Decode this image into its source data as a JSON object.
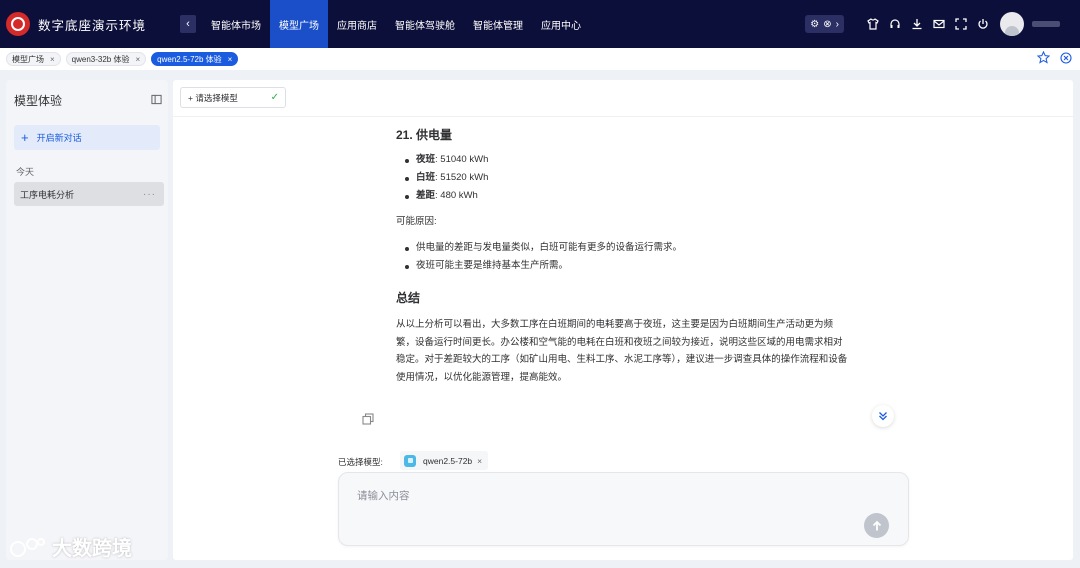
{
  "brand": {
    "title": "数字底座演示环境"
  },
  "nav": {
    "back_icon": "chevron-left-icon",
    "items": [
      {
        "label": "智能体市场",
        "active": false
      },
      {
        "label": "模型广场",
        "active": true
      },
      {
        "label": "应用商店",
        "active": false
      },
      {
        "label": "智能体驾驶舱",
        "active": false
      },
      {
        "label": "智能体管理",
        "active": false
      },
      {
        "label": "应用中心",
        "active": false
      }
    ]
  },
  "tabs": [
    {
      "label": "模型广场",
      "active": false
    },
    {
      "label": "qwen3-32b 体验",
      "active": false
    },
    {
      "label": "qwen2.5-72b 体验",
      "active": true
    }
  ],
  "sidebar": {
    "title": "模型体验",
    "new_chat": "开启新对话",
    "section": "今天",
    "conversations": [
      {
        "title": "工序电耗分析"
      }
    ]
  },
  "main": {
    "model_select": "+ 请选择模型",
    "content": {
      "heading1": "21. 供电量",
      "items": [
        {
          "key": "夜班",
          "value": ": 51040 kWh"
        },
        {
          "key": "白班",
          "value": ": 51520 kWh"
        },
        {
          "key": "差距",
          "value": ": 480 kWh"
        }
      ],
      "reason_label": "可能原因:",
      "reasons": [
        "供电量的差距与发电量类似，白班可能有更多的设备运行需求。",
        "夜班可能主要是维持基本生产所需。"
      ],
      "heading2": "总结",
      "summary": "从以上分析可以看出，大多数工序在白班期间的电耗要高于夜班，这主要是因为白班期间生产活动更为频繁，设备运行时间更长。办公楼和空气能的电耗在白班和夜班之间较为接近，说明这些区域的用电需求相对稳定。对于差距较大的工序（如矿山用电、生料工序、水泥工序等），建议进一步调查具体的操作流程和设备使用情况，以优化能源管理，提高能效。"
    },
    "selected_label": "已选择模型:",
    "selected_model": "qwen2.5-72b",
    "input_placeholder": "请输入内容"
  },
  "watermark": "大数跨境",
  "colors": {
    "nav_bg": "#0d0f3b",
    "accent": "#1a5be0",
    "check": "#2fae4a"
  }
}
